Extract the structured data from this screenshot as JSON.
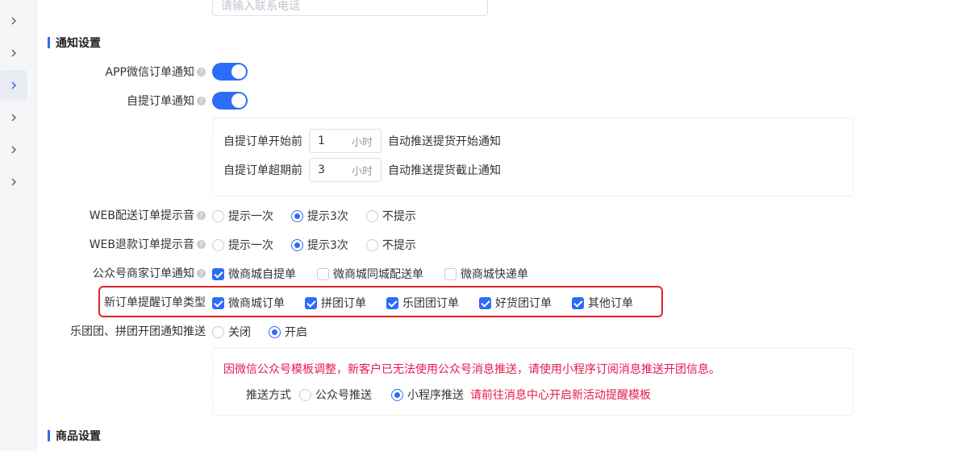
{
  "contact_phone": {
    "placeholder": "请输入联系电话"
  },
  "notice_section": {
    "title": "通知设置"
  },
  "app_wechat_notice": {
    "label": "APP微信订单通知",
    "enabled": true
  },
  "pickup_notice": {
    "label": "自提订单通知",
    "enabled": true
  },
  "pickup_before": {
    "label": "自提订单开始前",
    "value": "1",
    "unit": "小时",
    "desc": "自动推送提货开始通知"
  },
  "pickup_overdue": {
    "label": "自提订单超期前",
    "value": "3",
    "unit": "小时",
    "desc": "自动推送提货截止通知"
  },
  "web_delivery_sound": {
    "label": "WEB配送订单提示音",
    "options": [
      "提示一次",
      "提示3次",
      "不提示"
    ],
    "selected": "提示3次"
  },
  "web_refund_sound": {
    "label": "WEB退款订单提示音",
    "options": [
      "提示一次",
      "提示3次",
      "不提示"
    ],
    "selected": "提示3次"
  },
  "official_account_notice": {
    "label": "公众号商家订单通知",
    "options": [
      "微商城自提单",
      "微商城同城配送单",
      "微商城快递单"
    ],
    "checked": [
      "微商城自提单"
    ]
  },
  "new_order_types": {
    "label": "新订单提醒订单类型",
    "options": [
      "微商城订单",
      "拼团订单",
      "乐团团订单",
      "好货团订单",
      "其他订单"
    ]
  },
  "group_push": {
    "label": "乐团团、拼团开团通知推送",
    "options": [
      "关闭",
      "开启"
    ],
    "selected": "开启"
  },
  "group_push_box": {
    "warning": "因微信公众号模板调整，新客户已无法使用公众号消息推送，请使用小程序订阅消息推送开团信息。",
    "method_label": "推送方式",
    "methods": [
      "公众号推送",
      "小程序推送"
    ],
    "selected": "小程序推送",
    "hint": "请前往消息中心开启新活动提醒模板"
  },
  "goods_section": {
    "title": "商品设置"
  },
  "colors": {
    "primary": "#2d6cf6",
    "warning": "#e6194b",
    "highlight": "#e02424"
  }
}
